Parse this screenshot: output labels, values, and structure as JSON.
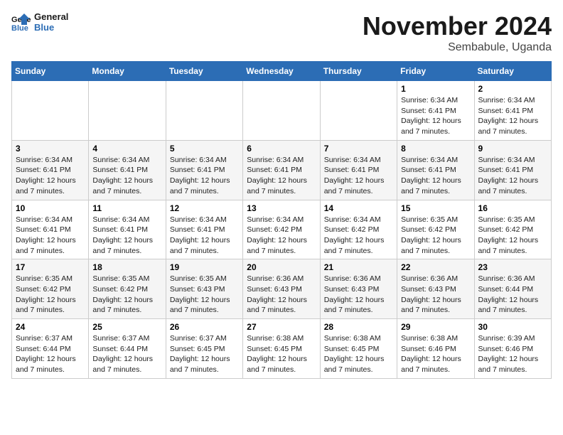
{
  "logo": {
    "line1": "General",
    "line2": "Blue"
  },
  "title": "November 2024",
  "subtitle": "Sembabule, Uganda",
  "headers": [
    "Sunday",
    "Monday",
    "Tuesday",
    "Wednesday",
    "Thursday",
    "Friday",
    "Saturday"
  ],
  "weeks": [
    [
      {
        "day": "",
        "info": ""
      },
      {
        "day": "",
        "info": ""
      },
      {
        "day": "",
        "info": ""
      },
      {
        "day": "",
        "info": ""
      },
      {
        "day": "",
        "info": ""
      },
      {
        "day": "1",
        "info": "Sunrise: 6:34 AM\nSunset: 6:41 PM\nDaylight: 12 hours\nand 7 minutes."
      },
      {
        "day": "2",
        "info": "Sunrise: 6:34 AM\nSunset: 6:41 PM\nDaylight: 12 hours\nand 7 minutes."
      }
    ],
    [
      {
        "day": "3",
        "info": "Sunrise: 6:34 AM\nSunset: 6:41 PM\nDaylight: 12 hours\nand 7 minutes."
      },
      {
        "day": "4",
        "info": "Sunrise: 6:34 AM\nSunset: 6:41 PM\nDaylight: 12 hours\nand 7 minutes."
      },
      {
        "day": "5",
        "info": "Sunrise: 6:34 AM\nSunset: 6:41 PM\nDaylight: 12 hours\nand 7 minutes."
      },
      {
        "day": "6",
        "info": "Sunrise: 6:34 AM\nSunset: 6:41 PM\nDaylight: 12 hours\nand 7 minutes."
      },
      {
        "day": "7",
        "info": "Sunrise: 6:34 AM\nSunset: 6:41 PM\nDaylight: 12 hours\nand 7 minutes."
      },
      {
        "day": "8",
        "info": "Sunrise: 6:34 AM\nSunset: 6:41 PM\nDaylight: 12 hours\nand 7 minutes."
      },
      {
        "day": "9",
        "info": "Sunrise: 6:34 AM\nSunset: 6:41 PM\nDaylight: 12 hours\nand 7 minutes."
      }
    ],
    [
      {
        "day": "10",
        "info": "Sunrise: 6:34 AM\nSunset: 6:41 PM\nDaylight: 12 hours\nand 7 minutes."
      },
      {
        "day": "11",
        "info": "Sunrise: 6:34 AM\nSunset: 6:41 PM\nDaylight: 12 hours\nand 7 minutes."
      },
      {
        "day": "12",
        "info": "Sunrise: 6:34 AM\nSunset: 6:41 PM\nDaylight: 12 hours\nand 7 minutes."
      },
      {
        "day": "13",
        "info": "Sunrise: 6:34 AM\nSunset: 6:42 PM\nDaylight: 12 hours\nand 7 minutes."
      },
      {
        "day": "14",
        "info": "Sunrise: 6:34 AM\nSunset: 6:42 PM\nDaylight: 12 hours\nand 7 minutes."
      },
      {
        "day": "15",
        "info": "Sunrise: 6:35 AM\nSunset: 6:42 PM\nDaylight: 12 hours\nand 7 minutes."
      },
      {
        "day": "16",
        "info": "Sunrise: 6:35 AM\nSunset: 6:42 PM\nDaylight: 12 hours\nand 7 minutes."
      }
    ],
    [
      {
        "day": "17",
        "info": "Sunrise: 6:35 AM\nSunset: 6:42 PM\nDaylight: 12 hours\nand 7 minutes."
      },
      {
        "day": "18",
        "info": "Sunrise: 6:35 AM\nSunset: 6:42 PM\nDaylight: 12 hours\nand 7 minutes."
      },
      {
        "day": "19",
        "info": "Sunrise: 6:35 AM\nSunset: 6:43 PM\nDaylight: 12 hours\nand 7 minutes."
      },
      {
        "day": "20",
        "info": "Sunrise: 6:36 AM\nSunset: 6:43 PM\nDaylight: 12 hours\nand 7 minutes."
      },
      {
        "day": "21",
        "info": "Sunrise: 6:36 AM\nSunset: 6:43 PM\nDaylight: 12 hours\nand 7 minutes."
      },
      {
        "day": "22",
        "info": "Sunrise: 6:36 AM\nSunset: 6:43 PM\nDaylight: 12 hours\nand 7 minutes."
      },
      {
        "day": "23",
        "info": "Sunrise: 6:36 AM\nSunset: 6:44 PM\nDaylight: 12 hours\nand 7 minutes."
      }
    ],
    [
      {
        "day": "24",
        "info": "Sunrise: 6:37 AM\nSunset: 6:44 PM\nDaylight: 12 hours\nand 7 minutes."
      },
      {
        "day": "25",
        "info": "Sunrise: 6:37 AM\nSunset: 6:44 PM\nDaylight: 12 hours\nand 7 minutes."
      },
      {
        "day": "26",
        "info": "Sunrise: 6:37 AM\nSunset: 6:45 PM\nDaylight: 12 hours\nand 7 minutes."
      },
      {
        "day": "27",
        "info": "Sunrise: 6:38 AM\nSunset: 6:45 PM\nDaylight: 12 hours\nand 7 minutes."
      },
      {
        "day": "28",
        "info": "Sunrise: 6:38 AM\nSunset: 6:45 PM\nDaylight: 12 hours\nand 7 minutes."
      },
      {
        "day": "29",
        "info": "Sunrise: 6:38 AM\nSunset: 6:46 PM\nDaylight: 12 hours\nand 7 minutes."
      },
      {
        "day": "30",
        "info": "Sunrise: 6:39 AM\nSunset: 6:46 PM\nDaylight: 12 hours\nand 7 minutes."
      }
    ]
  ]
}
